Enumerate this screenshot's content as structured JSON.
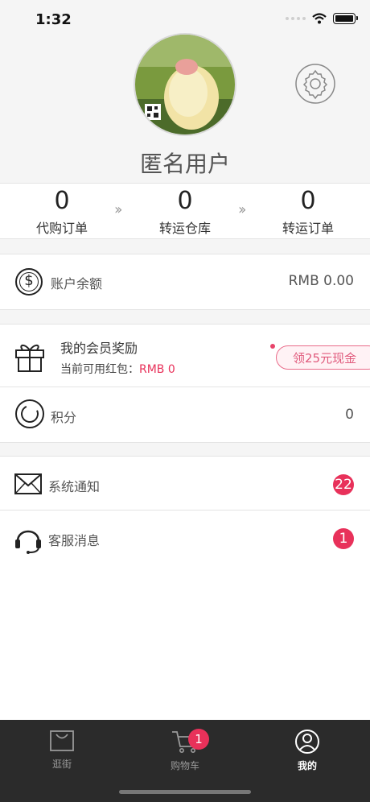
{
  "status_bar": {
    "time": "1:32"
  },
  "profile": {
    "username": "匿名用户"
  },
  "orders": [
    {
      "count": "0",
      "label": "代购订单"
    },
    {
      "count": "0",
      "label": "转运仓库"
    },
    {
      "count": "0",
      "label": "转运订单"
    }
  ],
  "order_arrow": "》",
  "balance": {
    "title": "账户余额",
    "value": "RMB 0.00",
    "icon_symbol": "$"
  },
  "rewards": {
    "title": "我的会员奖励",
    "red_packet_label": "当前可用红包：",
    "red_packet_value": "RMB 0",
    "cta": "领25元现金",
    "cta_chevron": "›"
  },
  "points": {
    "title": "积分",
    "value": "0"
  },
  "notifications": {
    "title": "系统通知",
    "badge": "22"
  },
  "service": {
    "title": "客服消息",
    "badge": "1"
  },
  "tabs": [
    {
      "label": "逛街"
    },
    {
      "label": "购物车",
      "badge": "1"
    },
    {
      "label": "我的"
    }
  ],
  "colors": {
    "accent_pink": "#e8315a",
    "tabbar_bg": "#2b2b2b",
    "page_bg": "#f5f5f5"
  },
  "icons": [
    "wifi-icon",
    "battery-icon",
    "settings-gear-icon",
    "dollar-coin-icon",
    "gift-icon",
    "points-ring-icon",
    "mail-icon",
    "headset-icon",
    "shopping-bag-icon",
    "cart-icon",
    "user-circle-icon"
  ]
}
